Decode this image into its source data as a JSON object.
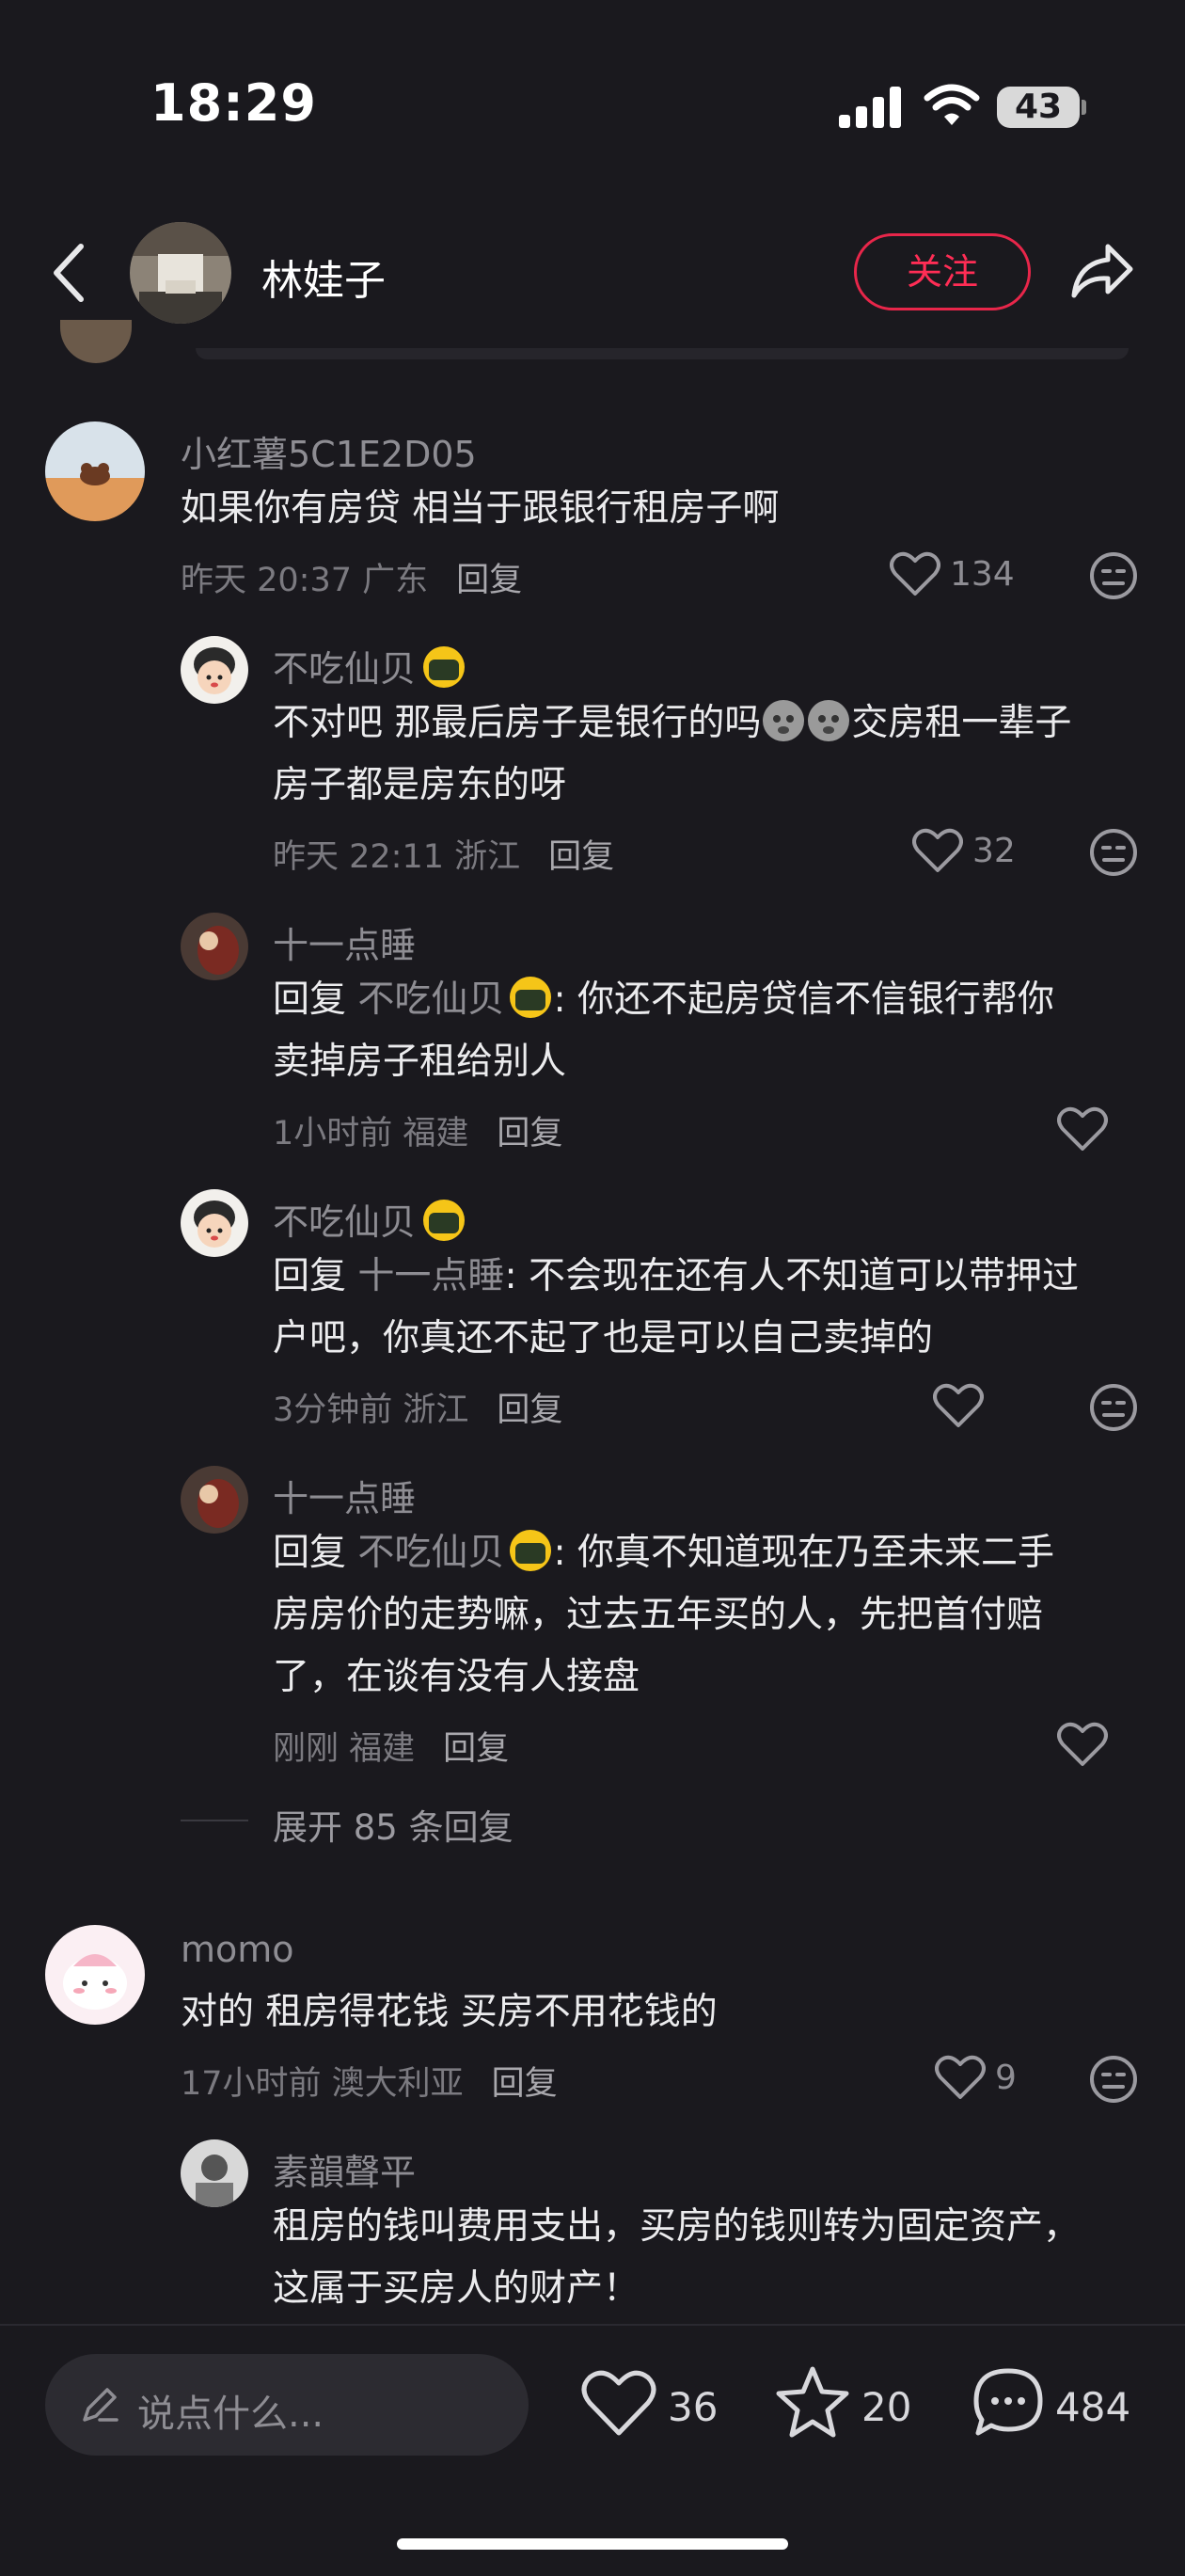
{
  "status_bar": {
    "time": "18:29",
    "battery": "43"
  },
  "header": {
    "author_name": "林娃子",
    "follow_label": "关注"
  },
  "comments": [
    {
      "user": "小红薯5C1E2D05",
      "text_lines": [
        "如果你有房贷 相当于跟银行租房子啊"
      ],
      "time": "昨天 20:37 广东",
      "reply_label": "回复",
      "likes": "134"
    },
    {
      "user": "不吃仙贝",
      "text_lines": [
        "不对吧 那最后房子是银行的吗",
        "交房租一辈子",
        "房子都是房东的呀"
      ],
      "time": "昨天 22:11 浙江",
      "reply_label": "回复",
      "likes": "32"
    },
    {
      "user": "十一点睡",
      "reply_prefix": "回复",
      "reply_to": "不吃仙贝",
      "text_lines": [
        ": 你还不起房贷信不信银行帮你",
        "卖掉房子租给别人"
      ],
      "time": "1小时前 福建",
      "reply_label": "回复"
    },
    {
      "user": "不吃仙贝",
      "reply_prefix": "回复",
      "reply_to": "十一点睡",
      "text_lines": [
        ": 不会现在还有人不知道可以带押过",
        "户吧，你真还不起了也是可以自己卖掉的"
      ],
      "time": "3分钟前 浙江",
      "reply_label": "回复"
    },
    {
      "user": "十一点睡",
      "reply_prefix": "回复",
      "reply_to": "不吃仙贝",
      "text_lines": [
        ": 你真不知道现在乃至未来二手",
        "房房价的走势嘛，过去五年买的人，先把首付赔",
        "了，在谈有没有人接盘"
      ],
      "time": "刚刚 福建",
      "reply_label": "回复"
    },
    {
      "user": "momo",
      "text_lines": [
        "对的 租房得花钱 买房不用花钱的"
      ],
      "time": "17小时前 澳大利亚",
      "reply_label": "回复",
      "likes": "9"
    },
    {
      "user": "素韻聲平",
      "text_lines": [
        "租房的钱叫费用支出，买房的钱则转为固定资产，",
        "这属于买房人的财产！"
      ]
    }
  ],
  "expand_replies": "展开 85 条回复",
  "bottom_bar": {
    "placeholder": "说点什么...",
    "likes": "36",
    "favorites": "20",
    "comments": "484"
  },
  "colors": {
    "background": "#1a191e",
    "accent": "#ff2d55"
  }
}
